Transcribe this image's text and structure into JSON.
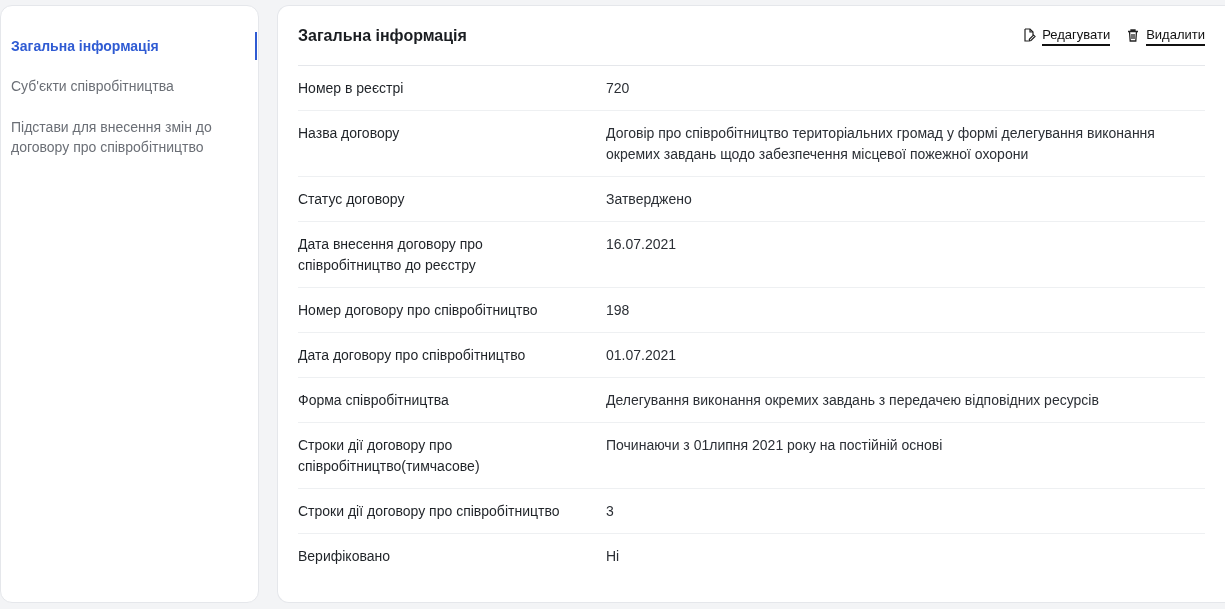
{
  "sidebar": {
    "items": [
      {
        "label": "Загальна інформація",
        "selected": true
      },
      {
        "label": "Суб'єкти співробітництва",
        "selected": false
      },
      {
        "label": "Підстави для внесення змін до договору про співробітництво",
        "selected": false
      }
    ]
  },
  "main": {
    "title": "Загальна інформація",
    "actions": [
      {
        "kind": "edit",
        "label": "Редагувати"
      },
      {
        "kind": "delete",
        "label": "Видалити"
      }
    ],
    "rows": [
      {
        "label": "Номер в реєстрі",
        "value": "720"
      },
      {
        "label": "Назва договору",
        "value": "Договір про співробітництво територіальних громад у формі делегування виконання окремих завдань щодо забезпечення місцевої пожежної охорони"
      },
      {
        "label": "Статус договору",
        "value": "Затверджено"
      },
      {
        "label": "Дата внесення договору про співробітництво до реєстру",
        "value": "16.07.2021"
      },
      {
        "label": "Номер договору про співробітництво",
        "value": "198"
      },
      {
        "label": "Дата договору про співробітництво",
        "value": "01.07.2021"
      },
      {
        "label": "Форма співробітництва",
        "value": "Делегування виконання окремих завдань з передачею відповідних ресурсів"
      },
      {
        "label": "Строки дії договору про співробітництво(тимчасове)",
        "value": "Починаючи з 01липня 2021 року на постійній основі"
      },
      {
        "label": "Строки дії договору про співробітництво",
        "value": "3"
      },
      {
        "label": "Верифіковано",
        "value": "Ні"
      }
    ]
  }
}
